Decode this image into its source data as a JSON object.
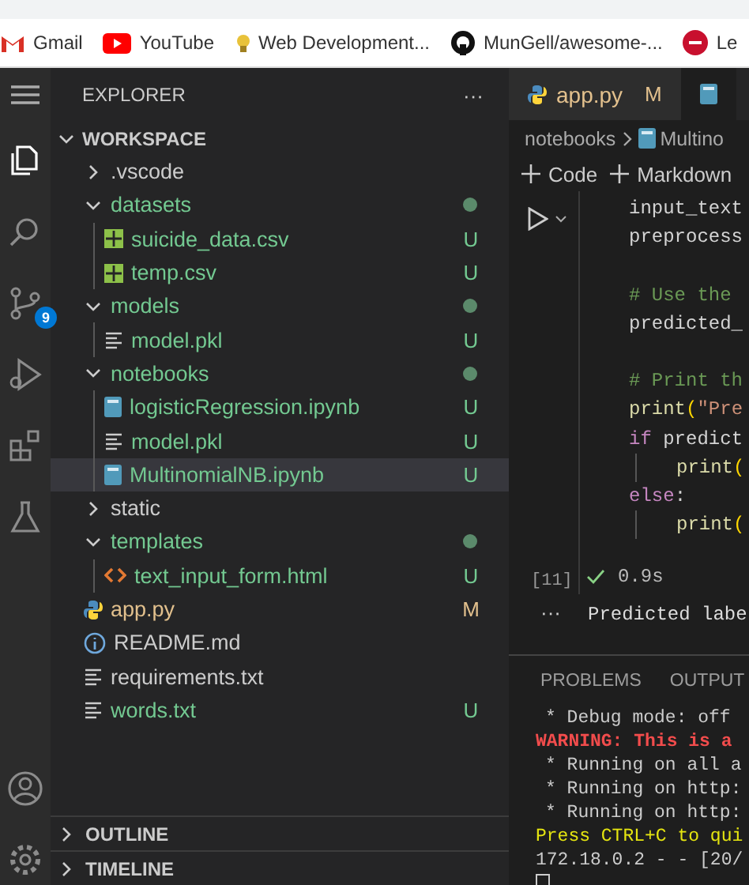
{
  "bookmarks": [
    {
      "label": "Gmail"
    },
    {
      "label": "YouTube"
    },
    {
      "label": "Web Development..."
    },
    {
      "label": "MunGell/awesome-..."
    },
    {
      "label": "Le"
    }
  ],
  "activity_bar": [
    {
      "selected": true
    },
    {
      "selected": false
    },
    {
      "selected": false,
      "badge": "9"
    },
    {
      "selected": false
    },
    {
      "selected": false
    },
    {
      "selected": false
    }
  ],
  "sidebar": {
    "title": "EXPLORER",
    "more": "···",
    "section": {
      "title": "WORKSPACE",
      "expanded": true
    },
    "tree": [
      {
        "name": ".vscode",
        "kind": "folder",
        "expanded": false,
        "color": "#cccccc",
        "selected": false
      },
      {
        "name": "datasets",
        "kind": "folder",
        "expanded": true,
        "color": "#73c991",
        "dot": true,
        "selected": false,
        "children": [
          {
            "name": "suicide_data.csv",
            "kind": "csv",
            "color": "#73c991",
            "badge": "U",
            "selected": false
          },
          {
            "name": "temp.csv",
            "kind": "csv",
            "color": "#73c991",
            "badge": "U",
            "selected": false
          }
        ]
      },
      {
        "name": "models",
        "kind": "folder",
        "expanded": true,
        "color": "#73c991",
        "dot": true,
        "selected": false,
        "children": [
          {
            "name": "model.pkl",
            "kind": "text",
            "color": "#73c991",
            "badge": "U",
            "selected": false
          }
        ]
      },
      {
        "name": "notebooks",
        "kind": "folder",
        "expanded": true,
        "color": "#73c991",
        "dot": true,
        "selected": false,
        "children": [
          {
            "name": "logisticRegression.ipynb",
            "kind": "notebook",
            "color": "#73c991",
            "badge": "U",
            "selected": false
          },
          {
            "name": "model.pkl",
            "kind": "text",
            "color": "#73c991",
            "badge": "U",
            "selected": false
          },
          {
            "name": "MultinomialNB.ipynb",
            "kind": "notebook",
            "color": "#73c991",
            "badge": "U",
            "selected": true
          }
        ]
      },
      {
        "name": "static",
        "kind": "folder",
        "expanded": false,
        "color": "#cccccc",
        "selected": false
      },
      {
        "name": "templates",
        "kind": "folder",
        "expanded": true,
        "color": "#73c991",
        "dot": true,
        "selected": false,
        "children": [
          {
            "name": "text_input_form.html",
            "kind": "html",
            "color": "#73c991",
            "badge": "U",
            "selected": false
          }
        ]
      },
      {
        "name": "app.py",
        "kind": "python",
        "color": "#e2c08d",
        "badge": "M",
        "selected": false
      },
      {
        "name": "README.md",
        "kind": "info",
        "color": "#cccccc",
        "selected": false
      },
      {
        "name": "requirements.txt",
        "kind": "text",
        "color": "#cccccc",
        "selected": false
      },
      {
        "name": "words.txt",
        "kind": "text",
        "color": "#73c991",
        "badge": "U",
        "selected": false
      }
    ],
    "panels": [
      {
        "title": "OUTLINE",
        "expanded": false
      },
      {
        "title": "TIMELINE",
        "expanded": false
      }
    ]
  },
  "editor": {
    "tabs": [
      {
        "label": "app.py",
        "badge": "M",
        "selected": false
      },
      {
        "selected": true
      }
    ],
    "breadcrumb": [
      {
        "label": "notebooks"
      },
      {
        "label": "Multino"
      }
    ],
    "toolbar": [
      {
        "label": "Code"
      },
      {
        "label": "Markdown"
      }
    ],
    "cell": {
      "lines": [
        {
          "kind": "code",
          "parts": [
            {
              "t": "input_text",
              "kind": "id"
            }
          ]
        },
        {
          "kind": "code",
          "parts": [
            {
              "t": "preprocess",
              "kind": "id"
            }
          ]
        },
        {
          "kind": "blank"
        },
        {
          "kind": "code",
          "parts": [
            {
              "t": "# Use the",
              "kind": "comment"
            }
          ]
        },
        {
          "kind": "code",
          "parts": [
            {
              "t": "predicted_",
              "kind": "id"
            }
          ]
        },
        {
          "kind": "blank"
        },
        {
          "kind": "code",
          "parts": [
            {
              "t": "# Print th",
              "kind": "comment"
            }
          ]
        },
        {
          "kind": "code",
          "parts": [
            {
              "t": "print",
              "kind": "fn"
            },
            {
              "t": "(",
              "kind": "paren"
            },
            {
              "t": "\"Pre",
              "kind": "str"
            }
          ]
        },
        {
          "kind": "code",
          "parts": [
            {
              "t": "if",
              "kind": "kw"
            },
            {
              "t": " predict",
              "kind": "id"
            }
          ],
          "children": [
            {
              "kind": "code",
              "parts": [
                {
                  "t": "print",
                  "kind": "fn"
                },
                {
                  "t": "(",
                  "kind": "paren"
                }
              ]
            }
          ]
        },
        {
          "kind": "code",
          "parts": [
            {
              "t": "else",
              "kind": "kw"
            },
            {
              "t": ":",
              "kind": "id"
            }
          ],
          "children": [
            {
              "kind": "code",
              "parts": [
                {
                  "t": "print",
                  "kind": "fn"
                },
                {
                  "t": "(",
                  "kind": "paren"
                }
              ]
            }
          ]
        }
      ],
      "count": "[11]",
      "succeeded": true,
      "time": "0.9s",
      "output_more": "···",
      "output": [
        "Predicted labe"
      ]
    }
  },
  "terminal": {
    "tabs": [
      {
        "label": "PROBLEMS",
        "selected": false
      },
      {
        "label": "OUTPUT",
        "selected": false
      }
    ],
    "lines": [
      {
        "text": "* Debug mode: off",
        "kind": "bullet"
      },
      {
        "text": "WARNING: This is a",
        "kind": "warning"
      },
      {
        "text": "* Running on all a",
        "kind": "bullet"
      },
      {
        "text": "* Running on http:",
        "kind": "bullet"
      },
      {
        "text": "* Running on http:",
        "kind": "bullet"
      },
      {
        "text": "Press CTRL+C to qui",
        "kind": "hint"
      },
      {
        "text": "172.18.0.2 - - [20/",
        "kind": "plain"
      }
    ],
    "cursor": true
  }
}
